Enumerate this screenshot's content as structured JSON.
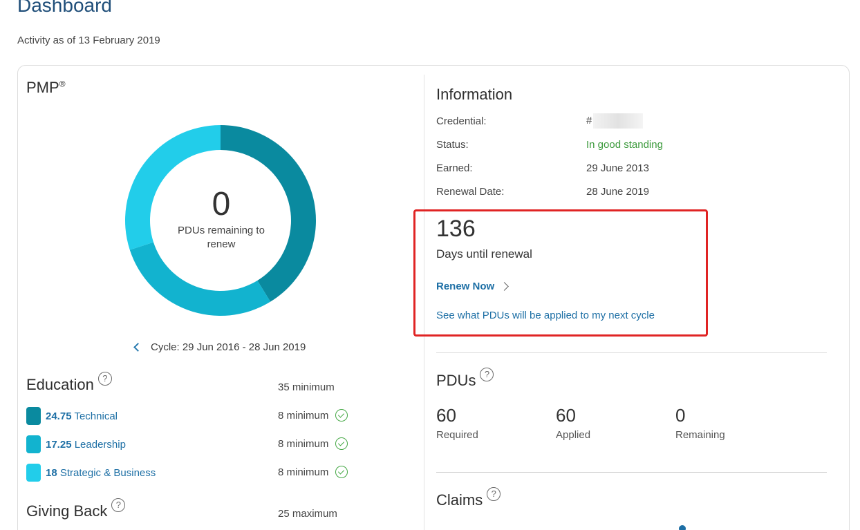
{
  "header": {
    "title": "Dashboard",
    "activity": "Activity as of 13 February 2019"
  },
  "certification": {
    "name": "PMP",
    "mark": "®",
    "donut": {
      "value": "0",
      "label_line1": "PDUs remaining to",
      "label_line2": "renew",
      "segments": [
        {
          "name": "Technical",
          "value": 24.75,
          "color": "#0a8a9f"
        },
        {
          "name": "Leadership",
          "value": 17.25,
          "color": "#12b3cf"
        },
        {
          "name": "Strategic & Business",
          "value": 18,
          "color": "#22cdea"
        }
      ]
    },
    "cycle": "Cycle: 29 Jun 2016 - 28 Jun 2019"
  },
  "education": {
    "title": "Education",
    "requirement": "35 minimum",
    "categories": [
      {
        "value": "24.75",
        "label": "Technical",
        "min": "8 minimum",
        "color": "#0a8a9f"
      },
      {
        "value": "17.25",
        "label": "Leadership",
        "min": "8 minimum",
        "color": "#12b3cf"
      },
      {
        "value": "18",
        "label": "Strategic & Business",
        "min": "8 minimum",
        "color": "#22cdea"
      }
    ]
  },
  "giving_back": {
    "title": "Giving Back",
    "requirement": "25 maximum"
  },
  "information": {
    "title": "Information",
    "credential_label": "Credential:",
    "credential_value": "#",
    "status_label": "Status:",
    "status_value": "In good standing",
    "earned_label": "Earned:",
    "earned_value": "29 June 2013",
    "renewal_label": "Renewal Date:",
    "renewal_value": "28 June 2019",
    "colors": {
      "good": "#3c9a3c",
      "link": "#1d6fa5",
      "highlight": "#e02424"
    }
  },
  "renewal": {
    "days": "136",
    "days_label": "Days until renewal",
    "renew_link": "Renew Now",
    "see_link": "See what PDUs will be applied to my next cycle"
  },
  "pdus": {
    "title": "PDUs",
    "required_value": "60",
    "required_label": "Required",
    "applied_value": "60",
    "applied_label": "Applied",
    "remaining_value": "0",
    "remaining_label": "Remaining"
  },
  "claims": {
    "title": "Claims"
  },
  "help_glyph": "?"
}
